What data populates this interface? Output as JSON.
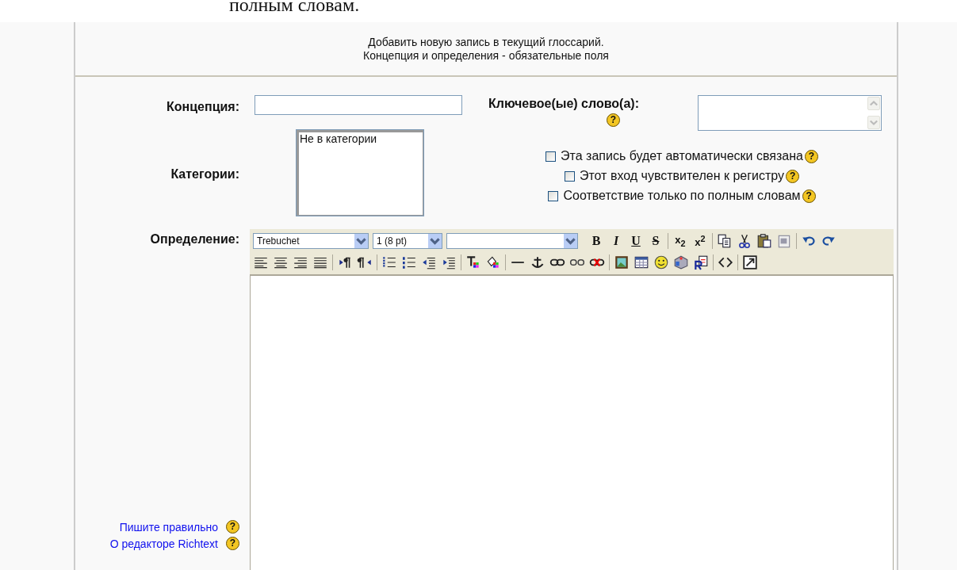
{
  "top_text": "полным словам.",
  "header": {
    "line_1": "Добавить новую запись в текущий глоссарий.",
    "line_2": "Концепция и определения - обязательные поля"
  },
  "concept": {
    "label": "Концепция:"
  },
  "keywords": {
    "label": "Ключевое(ые) слово(а):",
    "help": "?"
  },
  "categories": {
    "label": "Категории:",
    "options": [
      {
        "label": "Не в категории",
        "selected": false
      }
    ]
  },
  "options": [
    {
      "label": "Эта запись будет автоматически связана",
      "checked": false,
      "help": "?"
    },
    {
      "label": "Этот вход чувствителен к регистру",
      "checked": false,
      "help": "?"
    },
    {
      "label": "Соответствие только по полным словам",
      "checked": false,
      "help": "?"
    }
  ],
  "definition": {
    "label": "Определение:"
  },
  "toolbar_rows": [
    [
      {
        "kind": "select",
        "value": "Trebuchet"
      },
      {
        "kind": "select",
        "value": "1 (8 pt)"
      },
      {
        "kind": "select"
      },
      {
        "kind": "bold",
        "label": "B"
      },
      {
        "kind": "italic",
        "label": "I"
      },
      {
        "kind": "underline",
        "label": "U"
      },
      {
        "kind": "strike",
        "label": "S"
      },
      {
        "kind": "sep"
      },
      {
        "kind": "sub",
        "label": "x$_{2}$"
      },
      {
        "kind": "sup",
        "label": "x$^{2}$"
      },
      {
        "kind": "sep"
      },
      {
        "kind": "copy"
      },
      {
        "kind": "cut"
      },
      {
        "kind": "paste"
      },
      {
        "kind": "pasteword"
      },
      {
        "kind": "sep"
      },
      {
        "kind": "undo"
      },
      {
        "kind": "redo"
      }
    ],
    [
      {
        "kind": "alignleft"
      },
      {
        "kind": "aligncenter"
      },
      {
        "kind": "alignright"
      },
      {
        "kind": "justify"
      },
      {
        "kind": "sep"
      },
      {
        "kind": "ltr"
      },
      {
        "kind": "rtl"
      },
      {
        "kind": "sep"
      },
      {
        "kind": "ol"
      },
      {
        "kind": "ul"
      },
      {
        "kind": "outdent"
      },
      {
        "kind": "indent"
      },
      {
        "kind": "sep"
      },
      {
        "kind": "textcolor"
      },
      {
        "kind": "bgcolor"
      },
      {
        "kind": "sep"
      },
      {
        "kind": "hr"
      },
      {
        "kind": "anchor"
      },
      {
        "kind": "link"
      },
      {
        "kind": "unlink"
      },
      {
        "kind": "nolink"
      },
      {
        "kind": "sep"
      },
      {
        "kind": "image"
      },
      {
        "kind": "table"
      },
      {
        "kind": "smiley"
      },
      {
        "kind": "cube"
      },
      {
        "kind": "replace"
      },
      {
        "kind": "sep"
      },
      {
        "kind": "html"
      },
      {
        "kind": "sep"
      },
      {
        "kind": "fullscreen"
      }
    ]
  ],
  "help_links": [
    {
      "label": "Пишите правильно",
      "help": "?"
    },
    {
      "label": "О редакторе Richtext",
      "help": "?"
    }
  ]
}
